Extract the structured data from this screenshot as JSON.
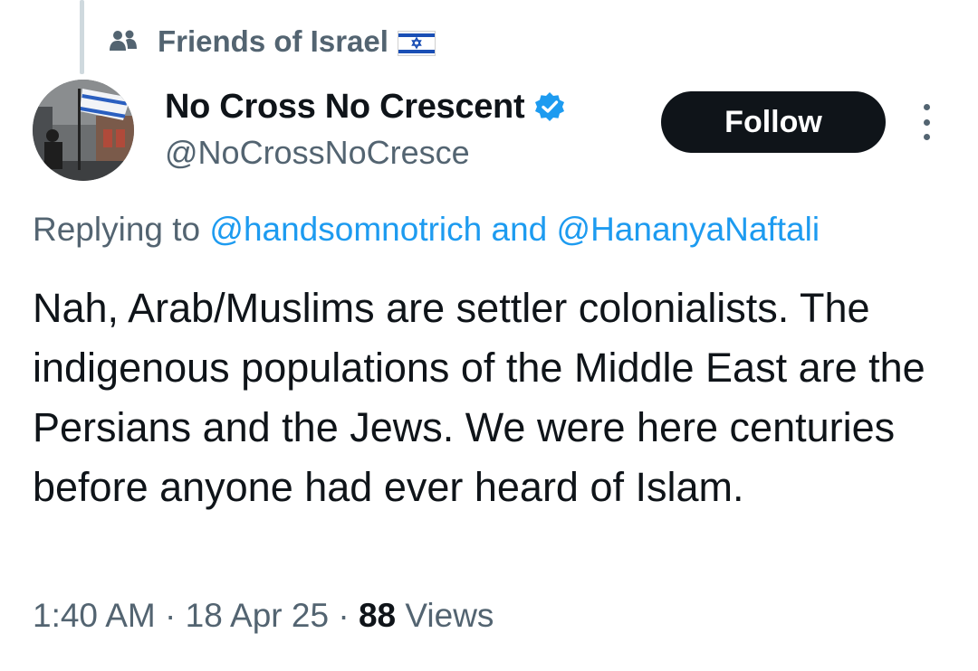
{
  "community": {
    "name": "Friends of Israel",
    "icon": "community-icon",
    "flag": "israel-flag-icon"
  },
  "author": {
    "display_name": "No Cross No Crescent",
    "handle": "@NoCrossNoCresce",
    "verified": true,
    "verified_color": "#1d9bf0"
  },
  "actions": {
    "follow_label": "Follow",
    "more_icon": "more-vertical-icon"
  },
  "reply_context": {
    "prefix": "Replying to",
    "mention_1": "@handsomnotrich",
    "conjunction": "and",
    "mention_2": "@HananyaNaftali"
  },
  "tweet": {
    "text": "Nah, Arab/Muslims are settler colonialists. The indigenous populations of the Middle East are the Persians and the Jews. We were here centuries before anyone had ever heard of Islam."
  },
  "meta": {
    "time": "1:40 AM",
    "separator": "·",
    "date": "18 Apr 25",
    "views_count": "88",
    "views_label": "Views"
  },
  "colors": {
    "text_primary": "#0f1419",
    "text_secondary": "#536471",
    "link": "#1d9bf0",
    "button_bg": "#0f1419",
    "thread_line": "#cfd9de"
  }
}
